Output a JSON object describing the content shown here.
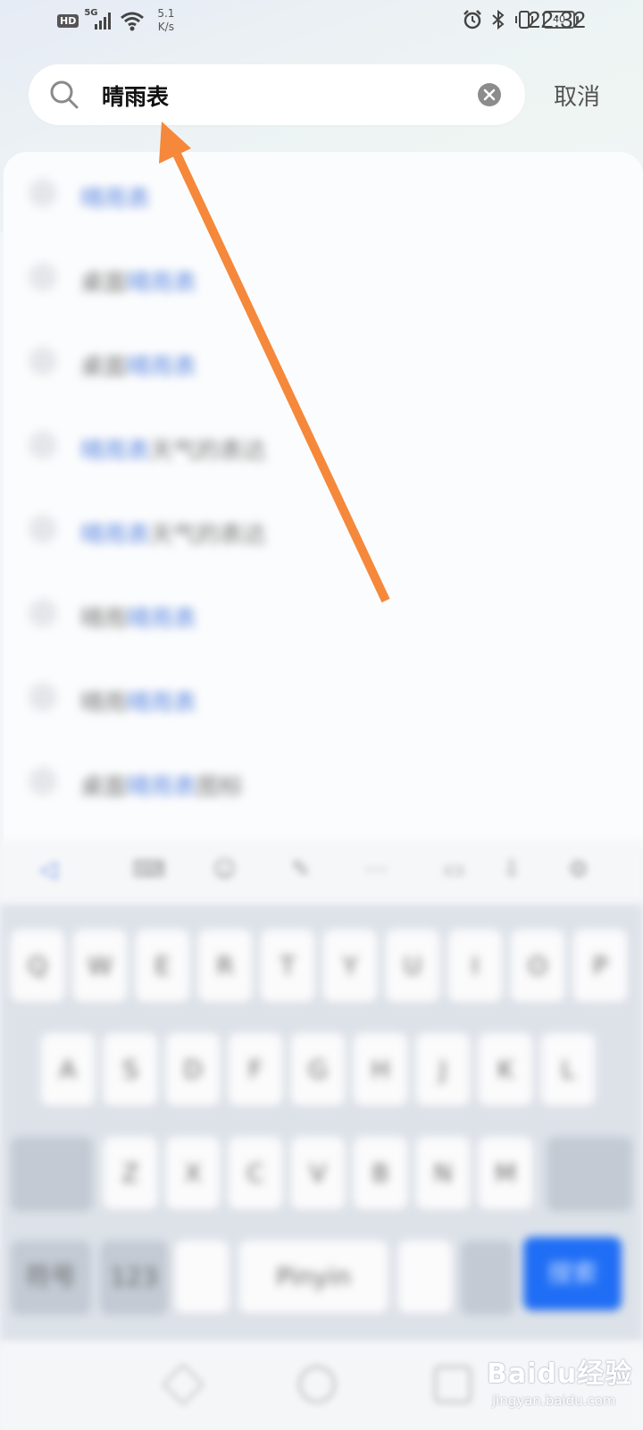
{
  "status_bar": {
    "hd": "HD",
    "network": "5G",
    "speed_value": "5.1",
    "speed_unit": "K/s",
    "battery": "40",
    "time": "22:32"
  },
  "search": {
    "query": "晴雨表",
    "cancel_label": "取消"
  },
  "suggestions": [
    {
      "prefix": "",
      "match": "晴雨表",
      "suffix": ""
    },
    {
      "prefix": "桌面",
      "match": "晴雨表",
      "suffix": ""
    },
    {
      "prefix": "桌面",
      "match": "晴雨表",
      "suffix": ""
    },
    {
      "prefix": "",
      "match": "晴雨表",
      "suffix": "天气的表达"
    },
    {
      "prefix": "",
      "match": "晴雨表",
      "suffix": "天气的表达"
    },
    {
      "prefix": "晴雨",
      "match": "晴雨表",
      "suffix": ""
    },
    {
      "prefix": "晴雨",
      "match": "晴雨表",
      "suffix": ""
    },
    {
      "prefix": "桌面",
      "match": "晴雨表",
      "suffix": "图标"
    }
  ],
  "keyboard": {
    "row1": [
      "Q",
      "W",
      "E",
      "R",
      "T",
      "Y",
      "U",
      "I",
      "O",
      "P"
    ],
    "row2": [
      "A",
      "S",
      "D",
      "F",
      "G",
      "H",
      "J",
      "K",
      "L"
    ],
    "row3": [
      "Z",
      "X",
      "C",
      "V",
      "B",
      "N",
      "M"
    ],
    "space_label": "Pinyin",
    "enter_label": "搜索",
    "symbol_label": "符号",
    "numeric_label": "123"
  },
  "watermark": {
    "brand": "Baidu经验",
    "url": "jingyan.baidu.com"
  },
  "colors": {
    "accent_arrow": "#f5883a",
    "enter_key": "#1f6ef5",
    "suggestion_match": "#5b86e0"
  }
}
